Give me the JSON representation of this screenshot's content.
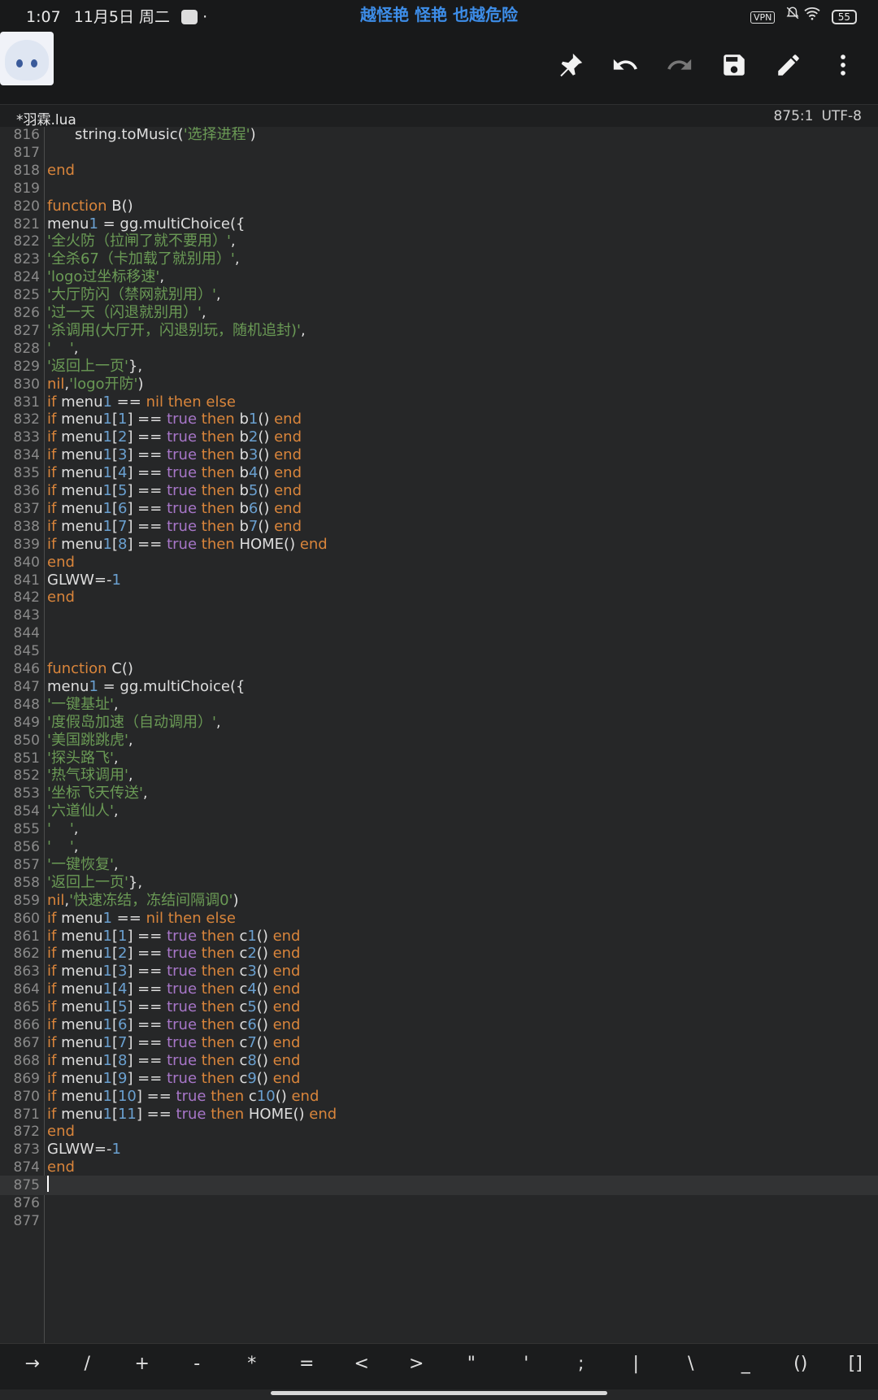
{
  "status_bar": {
    "time": "1:07",
    "date": "11月5日 周二",
    "center_text": "越怪艳 怪艳 也越危险",
    "vpn_label": "VPN",
    "battery": "55"
  },
  "toolbar": {
    "icons": [
      "pin-icon",
      "undo-icon",
      "redo-icon",
      "save-icon",
      "edit-icon",
      "more-icon"
    ]
  },
  "tab": {
    "filename": "*羽霖.lua",
    "cursor": "875:1",
    "encoding": "UTF-8"
  },
  "editor": {
    "current_line": "875",
    "lines": [
      {
        "n": "816",
        "code": "string.toMusic('选择进程')"
      },
      {
        "n": "817",
        "code": ""
      },
      {
        "n": "818",
        "code": "end"
      },
      {
        "n": "819",
        "code": ""
      },
      {
        "n": "820",
        "code": "function B()"
      },
      {
        "n": "821",
        "code": "menu1 = gg.multiChoice({"
      },
      {
        "n": "822",
        "code": "'全火防（拉闸了就不要用）',"
      },
      {
        "n": "823",
        "code": "'全杀67（卡加载了就别用）',"
      },
      {
        "n": "824",
        "code": "'logo过坐标移速',"
      },
      {
        "n": "825",
        "code": "'大厅防闪（禁网就别用）',"
      },
      {
        "n": "826",
        "code": "'过一天（闪退就别用）',"
      },
      {
        "n": "827",
        "code": "'杀调用(大厅开，闪退别玩，随机追封)',"
      },
      {
        "n": "828",
        "code": "'    ',"
      },
      {
        "n": "829",
        "code": "'返回上一页'},"
      },
      {
        "n": "830",
        "code": "nil,'logo开防')"
      },
      {
        "n": "831",
        "code": "if menu1 == nil then else"
      },
      {
        "n": "832",
        "code": "if menu1[1] == true then b1() end"
      },
      {
        "n": "833",
        "code": "if menu1[2] == true then b2() end"
      },
      {
        "n": "834",
        "code": "if menu1[3] == true then b3() end"
      },
      {
        "n": "835",
        "code": "if menu1[4] == true then b4() end"
      },
      {
        "n": "836",
        "code": "if menu1[5] == true then b5() end"
      },
      {
        "n": "837",
        "code": "if menu1[6] == true then b6() end"
      },
      {
        "n": "838",
        "code": "if menu1[7] == true then b7() end"
      },
      {
        "n": "839",
        "code": "if menu1[8] == true then HOME() end"
      },
      {
        "n": "840",
        "code": "end"
      },
      {
        "n": "841",
        "code": "GLWW=-1"
      },
      {
        "n": "842",
        "code": "end"
      },
      {
        "n": "843",
        "code": ""
      },
      {
        "n": "844",
        "code": ""
      },
      {
        "n": "845",
        "code": ""
      },
      {
        "n": "846",
        "code": "function C()"
      },
      {
        "n": "847",
        "code": "menu1 = gg.multiChoice({"
      },
      {
        "n": "848",
        "code": "'一键基址',"
      },
      {
        "n": "849",
        "code": "'度假岛加速（自动调用）',"
      },
      {
        "n": "850",
        "code": "'美国跳跳虎',"
      },
      {
        "n": "851",
        "code": "'探头路飞',"
      },
      {
        "n": "852",
        "code": "'热气球调用',"
      },
      {
        "n": "853",
        "code": "'坐标飞天传送',"
      },
      {
        "n": "854",
        "code": "'六道仙人',"
      },
      {
        "n": "855",
        "code": "'    ',"
      },
      {
        "n": "856",
        "code": "'    ',"
      },
      {
        "n": "857",
        "code": "'一键恢复',"
      },
      {
        "n": "858",
        "code": "'返回上一页'},"
      },
      {
        "n": "859",
        "code": "nil,'快速冻结，冻结间隔调0')"
      },
      {
        "n": "860",
        "code": "if menu1 == nil then else"
      },
      {
        "n": "861",
        "code": "if menu1[1] == true then c1() end"
      },
      {
        "n": "862",
        "code": "if menu1[2] == true then c2() end"
      },
      {
        "n": "863",
        "code": "if menu1[3] == true then c3() end"
      },
      {
        "n": "864",
        "code": "if menu1[4] == true then c4() end"
      },
      {
        "n": "865",
        "code": "if menu1[5] == true then c5() end"
      },
      {
        "n": "866",
        "code": "if menu1[6] == true then c6() end"
      },
      {
        "n": "867",
        "code": "if menu1[7] == true then c7() end"
      },
      {
        "n": "868",
        "code": "if menu1[8] == true then c8() end"
      },
      {
        "n": "869",
        "code": "if menu1[9] == true then c9() end"
      },
      {
        "n": "870",
        "code": "if menu1[10] == true then c10() end"
      },
      {
        "n": "871",
        "code": "if menu1[11] == true then HOME() end"
      },
      {
        "n": "872",
        "code": "end"
      },
      {
        "n": "873",
        "code": "GLWW=-1"
      },
      {
        "n": "874",
        "code": "end"
      },
      {
        "n": "875",
        "code": ""
      },
      {
        "n": "876",
        "code": ""
      },
      {
        "n": "877",
        "code": ""
      }
    ]
  },
  "symbol_bar": {
    "keys": [
      "→",
      "/",
      "+",
      "-",
      "*",
      "=",
      "<",
      ">",
      "\"",
      "'",
      ";",
      "|",
      "\\",
      "_",
      "()",
      "[]"
    ]
  },
  "colors": {
    "keyword": "#d9853b",
    "string": "#6a9a55",
    "number": "#6aa0d0",
    "boolean": "#a776c8",
    "status_center": "#3d8de8"
  }
}
